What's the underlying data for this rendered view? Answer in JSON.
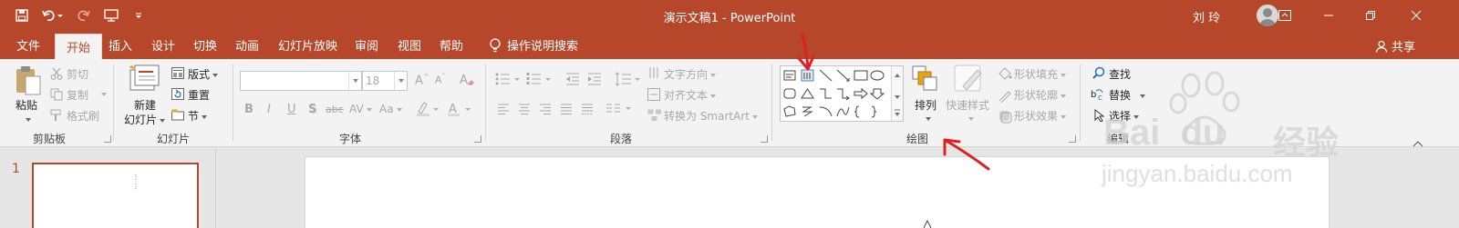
{
  "window": {
    "doc_title": "演示文稿1 - PowerPoint",
    "user_name": "刘 玲",
    "buttons": [
      "ribbon-display-options",
      "minimize",
      "restore",
      "close"
    ]
  },
  "tabs": [
    {
      "label": "文件",
      "active": false
    },
    {
      "label": "开始",
      "active": true
    },
    {
      "label": "插入",
      "active": false
    },
    {
      "label": "设计",
      "active": false
    },
    {
      "label": "切换",
      "active": false
    },
    {
      "label": "动画",
      "active": false
    },
    {
      "label": "幻灯片放映",
      "active": false
    },
    {
      "label": "审阅",
      "active": false
    },
    {
      "label": "视图",
      "active": false
    },
    {
      "label": "帮助",
      "active": false
    }
  ],
  "tell_me": "操作说明搜索",
  "share": "共享",
  "clipboard": {
    "label": "剪贴板",
    "paste": "粘贴",
    "cut": "剪切",
    "copy": "复制",
    "format_painter": "格式刷"
  },
  "slides": {
    "label": "幻灯片",
    "new_slide_1": "新建",
    "new_slide_2": "幻灯片",
    "layout": "版式",
    "reset": "重置",
    "section": "节"
  },
  "font": {
    "label": "字体",
    "font_name": "",
    "font_size": "18",
    "bold": "B",
    "italic": "I",
    "underline": "U",
    "shadow": "S",
    "strike": "abc",
    "spacing": "AV",
    "case": "Aa"
  },
  "paragraph": {
    "label": "段落",
    "text_direction": "文字方向",
    "align_text": "对齐文本",
    "smartart": "转换为 SmartArt"
  },
  "drawing": {
    "label": "绘图",
    "arrange": "排列",
    "quick_styles": "快速样式",
    "shape_fill": "形状填充",
    "shape_outline": "形状轮廓",
    "shape_effects": "形状效果"
  },
  "editing": {
    "label": "编辑",
    "find": "查找",
    "replace": "替换",
    "select": "选择"
  },
  "slide_panel": {
    "slide_number": "1"
  },
  "watermark": {
    "brand": "Bai",
    "brand2": "du",
    "product": "经验",
    "url": "jingyan.baidu.com"
  },
  "colors": {
    "accent": "#b7472a",
    "ribbon": "#f3f3f3",
    "annotation": "#e02020"
  }
}
